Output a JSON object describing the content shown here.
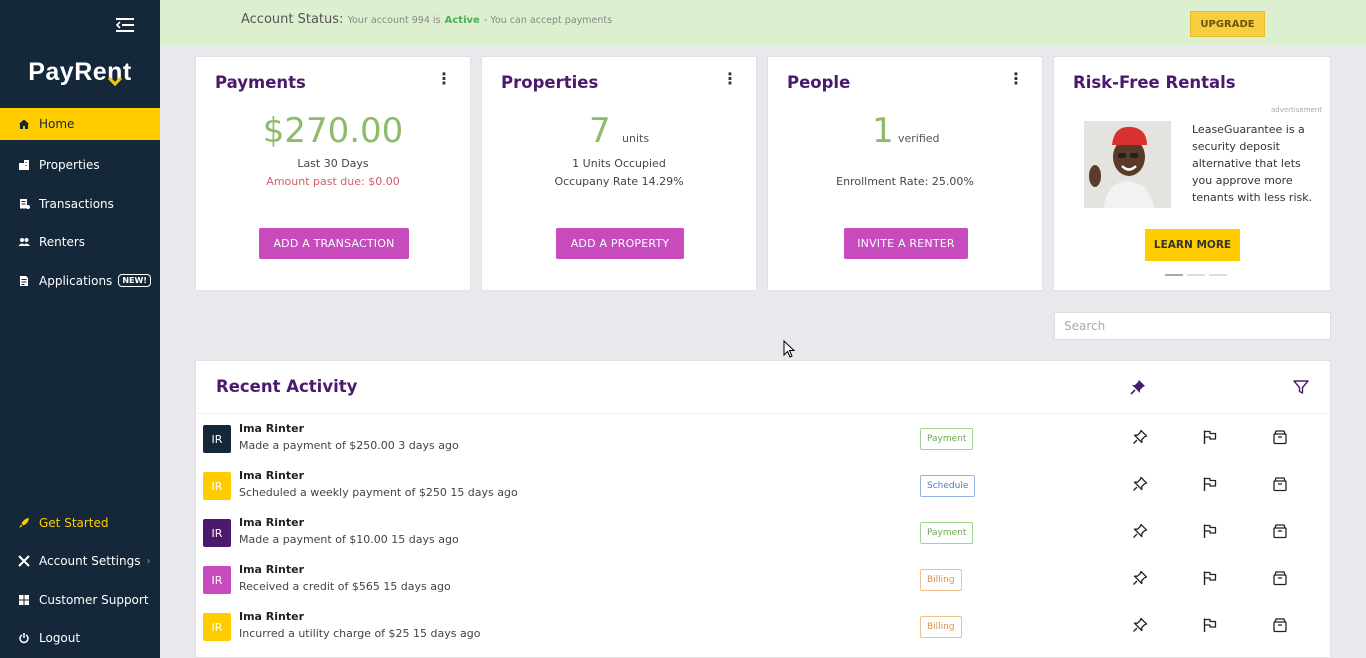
{
  "sidebar": {
    "brand": "PayRent",
    "items": [
      {
        "label": "Home",
        "icon": "home-icon"
      },
      {
        "label": "Properties",
        "icon": "building-icon"
      },
      {
        "label": "Transactions",
        "icon": "receipt-icon"
      },
      {
        "label": "Renters",
        "icon": "people-icon"
      },
      {
        "label": "Applications",
        "icon": "document-icon",
        "badge": "NEW!"
      }
    ],
    "bottom_items": [
      {
        "label": "Get Started",
        "icon": "rocket-icon"
      },
      {
        "label": "Account Settings",
        "icon": "tools-icon"
      },
      {
        "label": "Customer Support",
        "icon": "support-icon"
      },
      {
        "label": "Logout",
        "icon": "power-icon"
      }
    ]
  },
  "status": {
    "label": "Account Status:",
    "prefix": "Your account 994 is",
    "state": "Active",
    "suffix": "- You can accept payments",
    "upgrade": "UPGRADE"
  },
  "cards": {
    "payments": {
      "title": "Payments",
      "amount": "$270.00",
      "period": "Last 30 Days",
      "past_due": "Amount past due: $0.00",
      "button": "ADD A TRANSACTION"
    },
    "properties": {
      "title": "Properties",
      "count": "7",
      "unit": "units",
      "occupied": "1 Units Occupied",
      "rate": "Occupany Rate 14.29%",
      "button": "ADD A PROPERTY"
    },
    "people": {
      "title": "People",
      "count": "1",
      "unit": "verified",
      "rate": "Enrollment Rate: 25.00%",
      "button": "INVITE A RENTER"
    },
    "ad": {
      "title": "Risk-Free Rentals",
      "label": "advertisement",
      "text": "LeaseGuarantee is a security deposit alternative that lets you approve more tenants with less risk.",
      "button": "LEARN MORE"
    }
  },
  "search": {
    "placeholder": "Search"
  },
  "activity": {
    "title": "Recent Activity",
    "rows": [
      {
        "initials": "IR",
        "color": "#15283a",
        "name": "Ima Rinter",
        "desc": "Made a payment of $250.00 3 days ago",
        "tag": "Payment",
        "tag_type": "payment"
      },
      {
        "initials": "IR",
        "color": "#ffcc00",
        "name": "Ima Rinter",
        "desc": "Scheduled a weekly payment of $250 15 days ago",
        "tag": "Schedule",
        "tag_type": "schedule"
      },
      {
        "initials": "IR",
        "color": "#4b1a6e",
        "name": "Ima Rinter",
        "desc": "Made a payment of $10.00 15 days ago",
        "tag": "Payment",
        "tag_type": "payment"
      },
      {
        "initials": "IR",
        "color": "#c74bbd",
        "name": "Ima Rinter",
        "desc": "Received a credit of $565 15 days ago",
        "tag": "Billing",
        "tag_type": "billing"
      },
      {
        "initials": "IR",
        "color": "#ffcc00",
        "name": "Ima Rinter",
        "desc": "Incurred a utility charge of $25 15 days ago",
        "tag": "Billing",
        "tag_type": "billing"
      }
    ]
  },
  "colors": {
    "sidebar": "#15283a",
    "accent_yellow": "#ffcc00",
    "brand_purple": "#4b1a6e",
    "button_pink": "#c74bbd",
    "money_green": "#8dbb6a"
  }
}
